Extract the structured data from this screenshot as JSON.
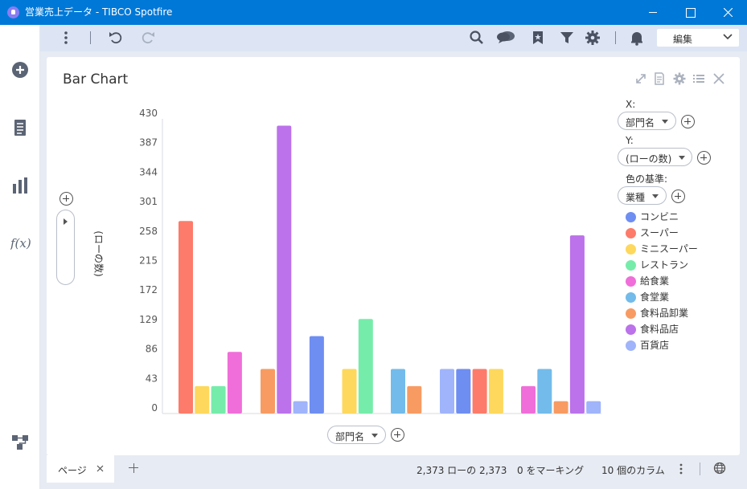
{
  "window": {
    "title": "営業売上データ - TIBCO Spotfire"
  },
  "toolbar": {
    "edit_label": "編集"
  },
  "visualization": {
    "title": "Bar Chart",
    "x_axis_selector": "部門名",
    "y_axis_selector": "(ローの数)",
    "bottom_axis_selector": "部門名",
    "legend": {
      "x_label": "X:",
      "y_label": "Y:",
      "color_by_label": "色の基準:",
      "color_by_value": "業種"
    }
  },
  "statusbar": {
    "page_tab": "ページ",
    "rows": "2,373 ローの 2,373",
    "marked": "0 をマーキング",
    "columns": "10 個のカラム"
  },
  "chart_data": {
    "type": "bar",
    "y_ticks": [
      "0",
      "43",
      "86",
      "129",
      "172",
      "215",
      "258",
      "301",
      "344",
      "387",
      "430"
    ],
    "ylim": [
      0,
      430
    ],
    "categories": [
      "",
      "",
      "",
      "",
      ""
    ],
    "series": [
      {
        "name": "コンビニ",
        "color": "#6f8ef2",
        "values": [
          null,
          113,
          null,
          65,
          null
        ]
      },
      {
        "name": "スーパー",
        "color": "#fd7b6a",
        "values": [
          281,
          null,
          null,
          65,
          null
        ]
      },
      {
        "name": "ミニスーパー",
        "color": "#fdd85c",
        "values": [
          40,
          65,
          null,
          65,
          null
        ]
      },
      {
        "name": "レストラン",
        "color": "#76ecaa",
        "values": [
          40,
          138,
          null,
          null,
          null
        ]
      },
      {
        "name": "給食業",
        "color": "#f06ed9",
        "values": [
          90,
          null,
          null,
          null,
          40
        ]
      },
      {
        "name": "食堂業",
        "color": "#72bbeb",
        "values": [
          null,
          null,
          65,
          null,
          65
        ]
      },
      {
        "name": "食料品卸業",
        "color": "#f89b62",
        "values": [
          null,
          65,
          40,
          null,
          18
        ]
      },
      {
        "name": "食料品店",
        "color": "#bb72ea",
        "values": [
          null,
          420,
          null,
          null,
          260
        ]
      },
      {
        "name": "百貨店",
        "color": "#9fb4fa",
        "values": [
          null,
          18,
          null,
          65,
          18
        ]
      }
    ],
    "bar_slots": [
      [
        1,
        2,
        3,
        4
      ],
      [
        6,
        7,
        8,
        0,
        1,
        2,
        3
      ],
      [
        5,
        6
      ],
      [
        8,
        0,
        1,
        2
      ],
      [
        4,
        5,
        6,
        7,
        8
      ]
    ]
  }
}
